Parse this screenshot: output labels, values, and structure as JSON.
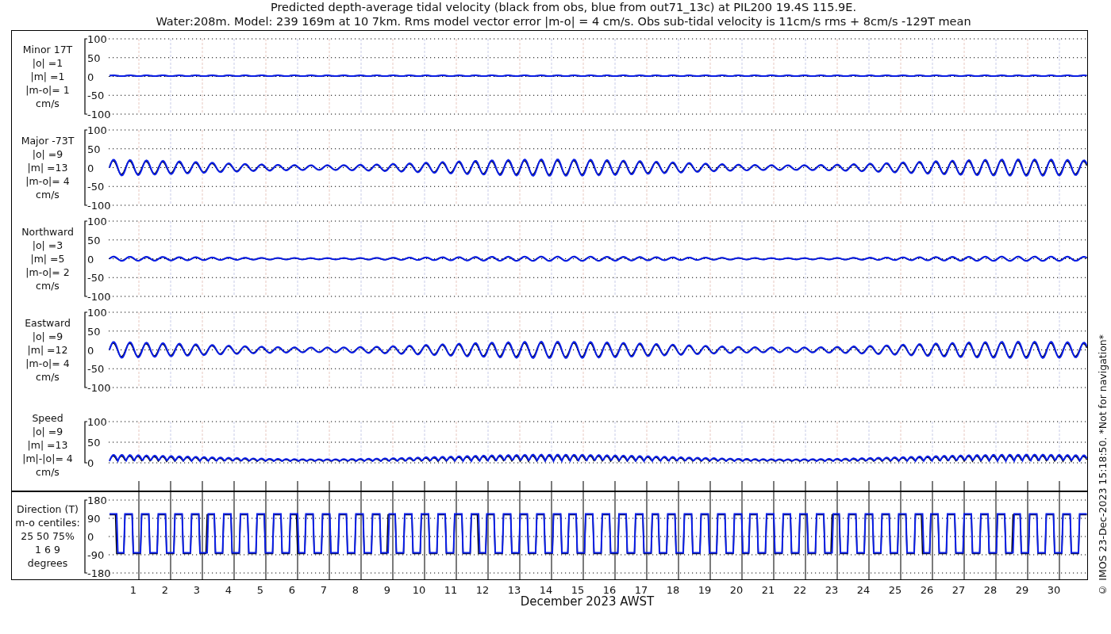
{
  "title": [
    "Predicted depth-average tidal velocity (black from obs, blue from out71_13c) at PIL200 19.4S 115.9E.",
    "Water:208m. Model: 239 169m at 10 7km. Rms model vector error |m-o| = 4 cm/s. Obs sub-tidal velocity is 11cm/s rms + 8cm/s -129T mean"
  ],
  "panels": [
    {
      "kind": "flat",
      "label": [
        "Minor 17T",
        "|o| =1",
        "|m| =1",
        "|m-o|= 1",
        "cm/s"
      ],
      "yticks": [
        "100",
        "50",
        "0",
        "-50",
        "-100"
      ]
    },
    {
      "kind": "wave",
      "label": [
        "Major -73T",
        "|o| =9",
        "|m| =13",
        "|m-o|= 4",
        "cm/s"
      ],
      "yticks": [
        "100",
        "50",
        "0",
        "-50",
        "-100"
      ]
    },
    {
      "kind": "ripple",
      "label": [
        "Northward",
        "|o| =3",
        "|m| =5",
        "|m-o|= 2",
        "cm/s"
      ],
      "yticks": [
        "100",
        "50",
        "0",
        "-50",
        "-100"
      ]
    },
    {
      "kind": "wave",
      "label": [
        "Eastward",
        "|o| =9",
        "|m| =12",
        "|m-o|= 4",
        "cm/s"
      ],
      "yticks": [
        "100",
        "50",
        "0",
        "-50",
        "-100"
      ]
    },
    {
      "kind": "speed",
      "label": [
        "Speed",
        "|o| =9",
        "|m| =13",
        "|m|-|o|= 4",
        "cm/s"
      ],
      "yticks": [
        "100",
        "50",
        "0"
      ]
    },
    {
      "kind": "direction",
      "label": [
        "Direction (T)",
        "m-o centiles:",
        "25  50  75%",
        "1  6  9",
        "degrees"
      ],
      "yticks": [
        "180",
        "90",
        "0",
        "-90",
        "-180"
      ]
    }
  ],
  "days": [
    "1",
    "2",
    "3",
    "4",
    "5",
    "6",
    "7",
    "8",
    "9",
    "10",
    "11",
    "12",
    "13",
    "14",
    "15",
    "16",
    "17",
    "18",
    "19",
    "20",
    "21",
    "22",
    "23",
    "24",
    "25",
    "26",
    "27",
    "28",
    "29",
    "30"
  ],
  "xlabel": "December 2023 AWST",
  "credit": "© IMOS 23-Dec-2023 15:18:50. *Not for navigation*"
}
